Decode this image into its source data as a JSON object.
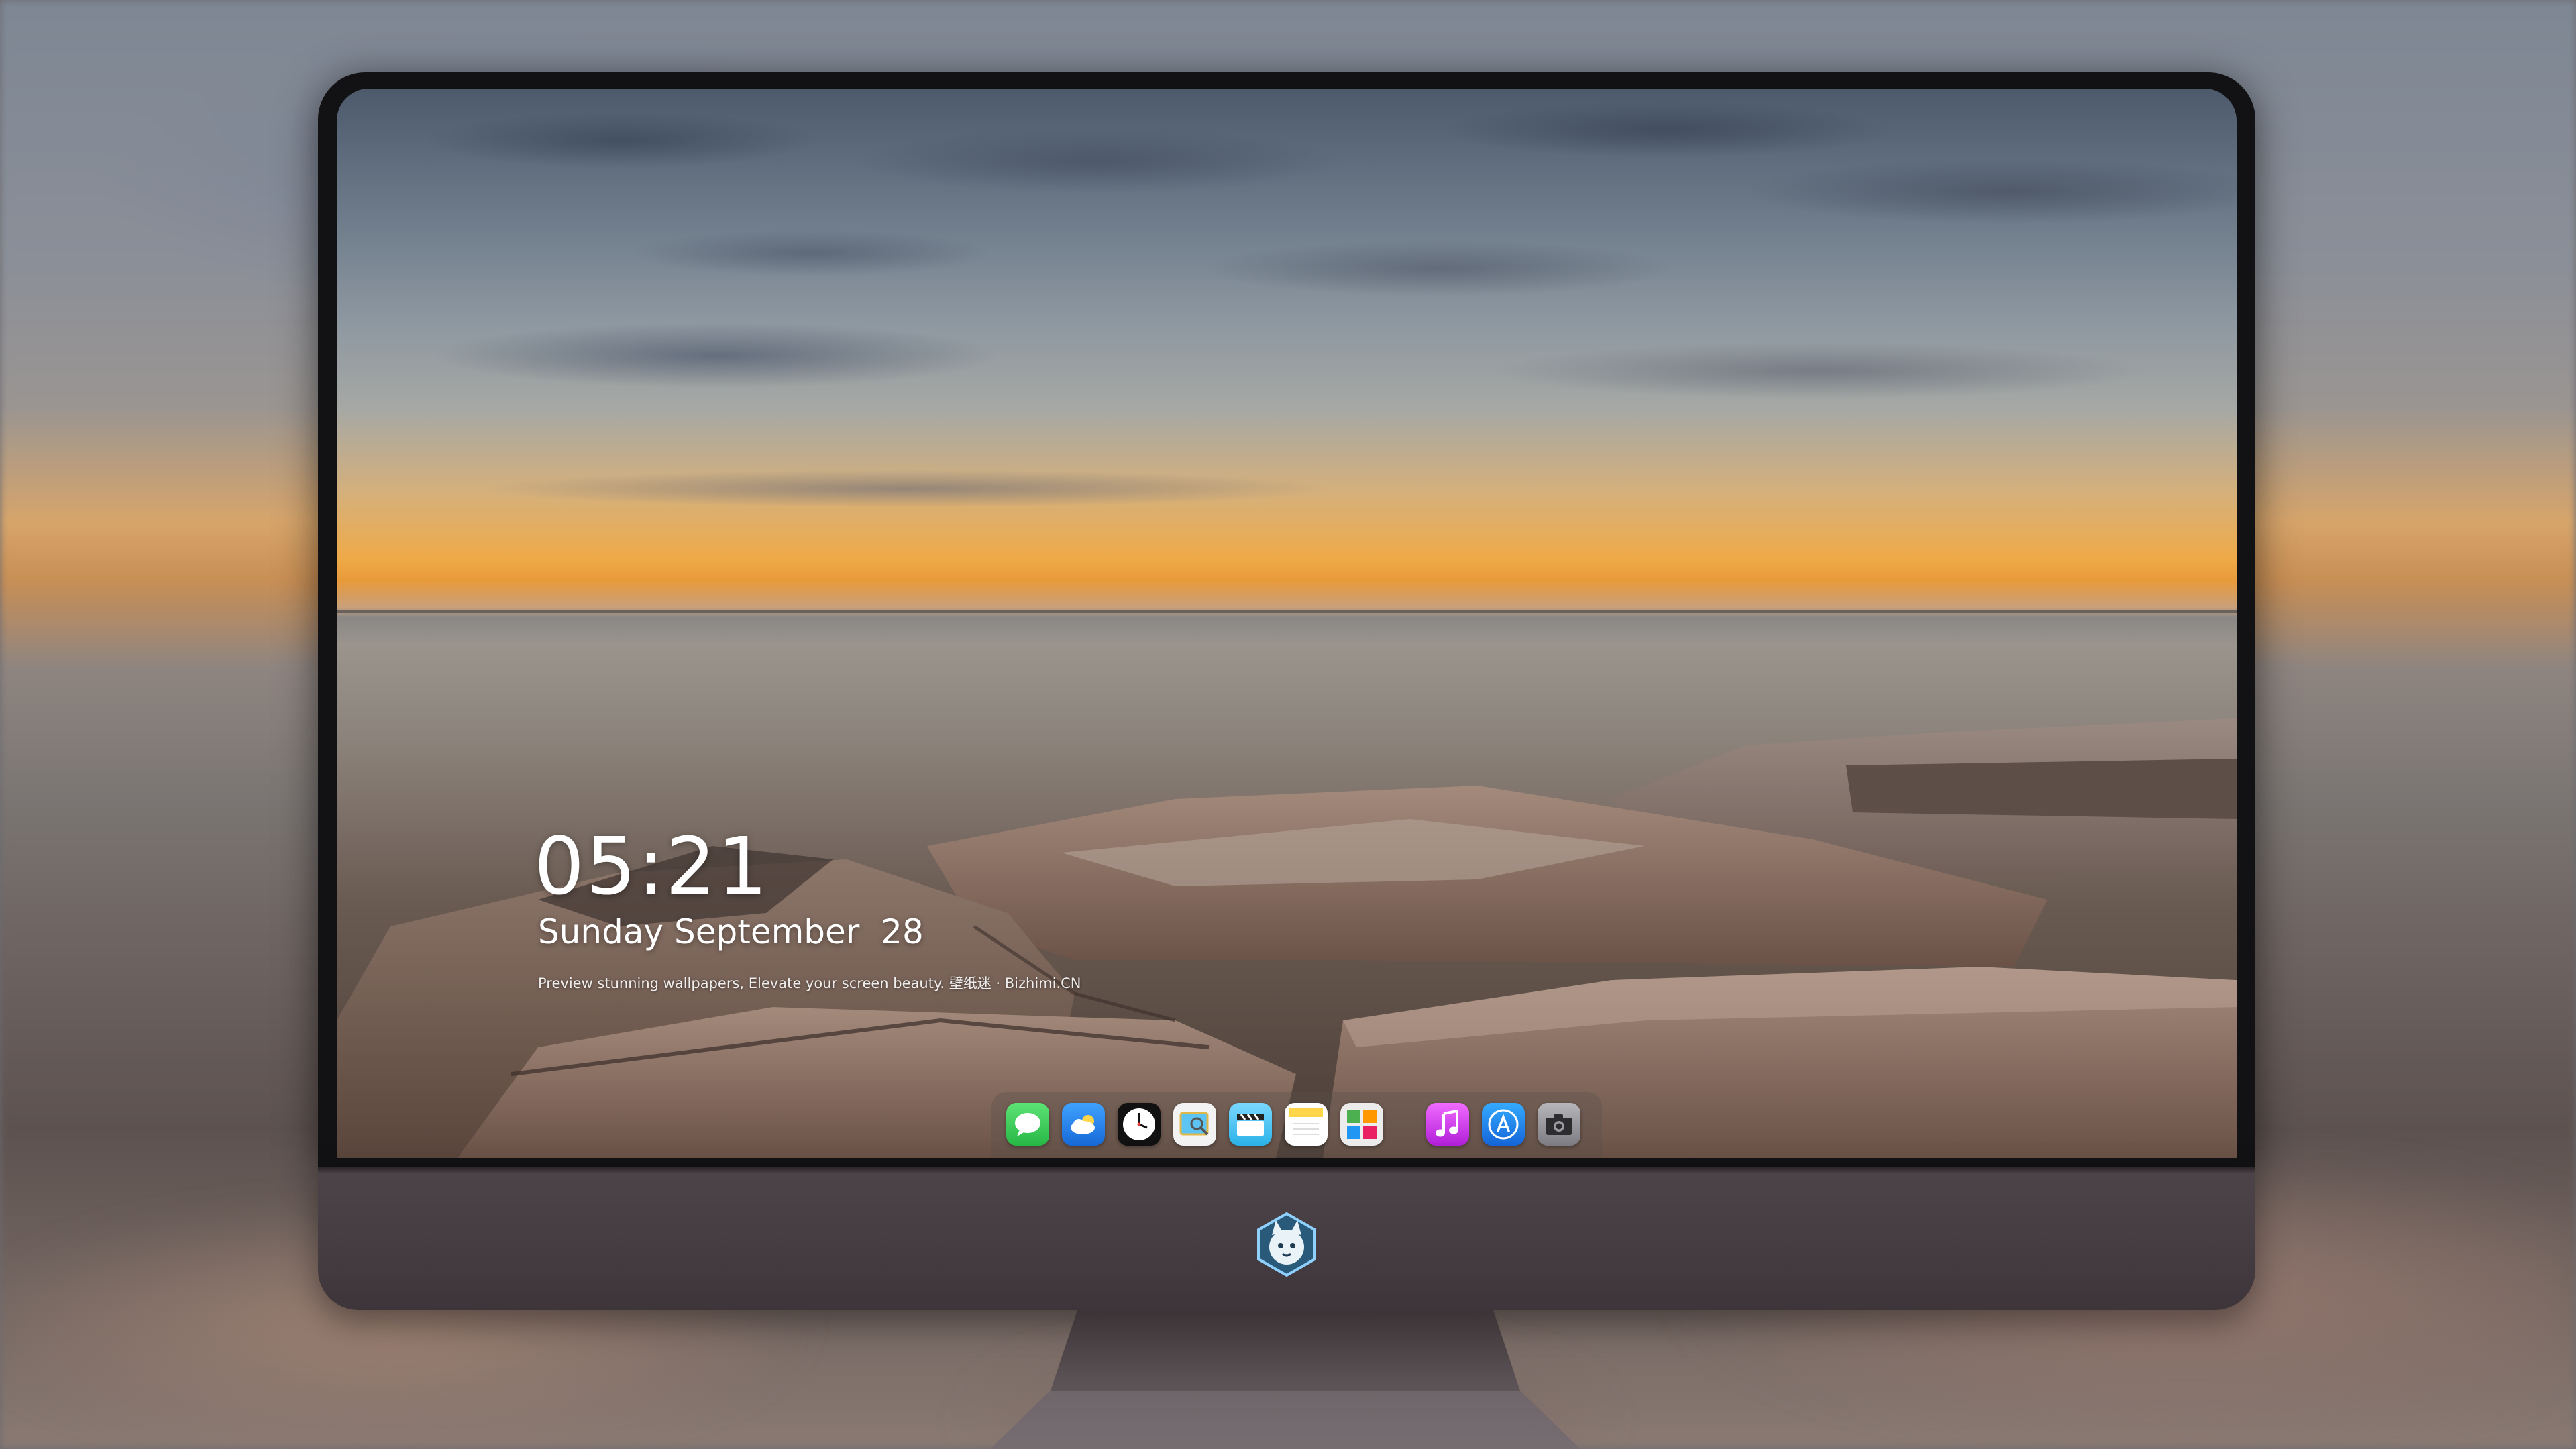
{
  "lock_screen": {
    "time": "05:21",
    "date": "Sunday September  28",
    "tagline": "Preview stunning wallpapers, Elevate your screen beauty. 壁纸迷 · Bizhimi.CN"
  },
  "dock": {
    "apps": [
      {
        "name": "Messages",
        "icon": "message-bubble-icon",
        "color": "#34c759"
      },
      {
        "name": "Weather",
        "icon": "cloud-icon",
        "color": "#1e90ff"
      },
      {
        "name": "Clock",
        "icon": "clock-icon",
        "color": "#1c1c1e"
      },
      {
        "name": "Preview",
        "icon": "preview-icon",
        "color": "#f2f2f2"
      },
      {
        "name": "Clips",
        "icon": "clapperboard-icon",
        "color": "#5ac8fa"
      },
      {
        "name": "Notes",
        "icon": "notes-icon",
        "color": "#ffd54a"
      },
      {
        "name": "Photo Booth",
        "icon": "photo-grid-icon",
        "color": "#e8e8e8"
      },
      {
        "name": "iTunes",
        "icon": "music-note-icon",
        "color": "#e040fb"
      },
      {
        "name": "App Store",
        "icon": "app-store-icon",
        "color": "#1e88e5"
      },
      {
        "name": "Camera",
        "icon": "camera-icon",
        "color": "#8e8e93"
      }
    ]
  },
  "monitor": {
    "logo": "fox-mascot-logo"
  }
}
